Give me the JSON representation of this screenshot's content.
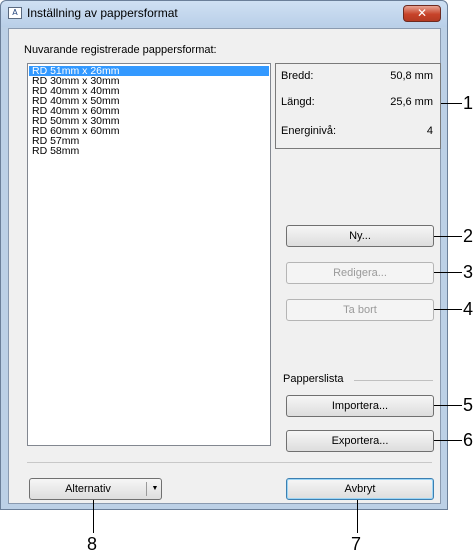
{
  "window": {
    "title": "Inställning av pappersformat",
    "close_glyph": "✕",
    "icon": "paper-settings-icon"
  },
  "list": {
    "label": "Nuvarande registrerade pappersformat:",
    "items": [
      "RD 51mm x 26mm",
      "RD 30mm x 30mm",
      "RD 40mm x 40mm",
      "RD 40mm x 50mm",
      "RD 40mm x 60mm",
      "RD 50mm x 30mm",
      "RD 60mm x 60mm",
      "RD 57mm",
      "RD 58mm"
    ],
    "selected_index": 0
  },
  "info": {
    "width_label": "Bredd:",
    "width_value": "50,8 mm",
    "length_label": "Längd:",
    "length_value": "25,6 mm",
    "energy_label": "Energinivå:",
    "energy_value": "4"
  },
  "buttons": {
    "new": "Ny...",
    "edit": "Redigera...",
    "delete": "Ta bort",
    "import": "Importera...",
    "export": "Exportera...",
    "options": "Alternativ",
    "cancel": "Avbryt"
  },
  "paper_list": {
    "label": "Papperslista"
  },
  "callouts": [
    "1",
    "2",
    "3",
    "4",
    "5",
    "6",
    "7",
    "8"
  ],
  "colors": {
    "selection": "#3399ff",
    "close_button": "#c7432a",
    "frame": "#bcd0e6"
  }
}
